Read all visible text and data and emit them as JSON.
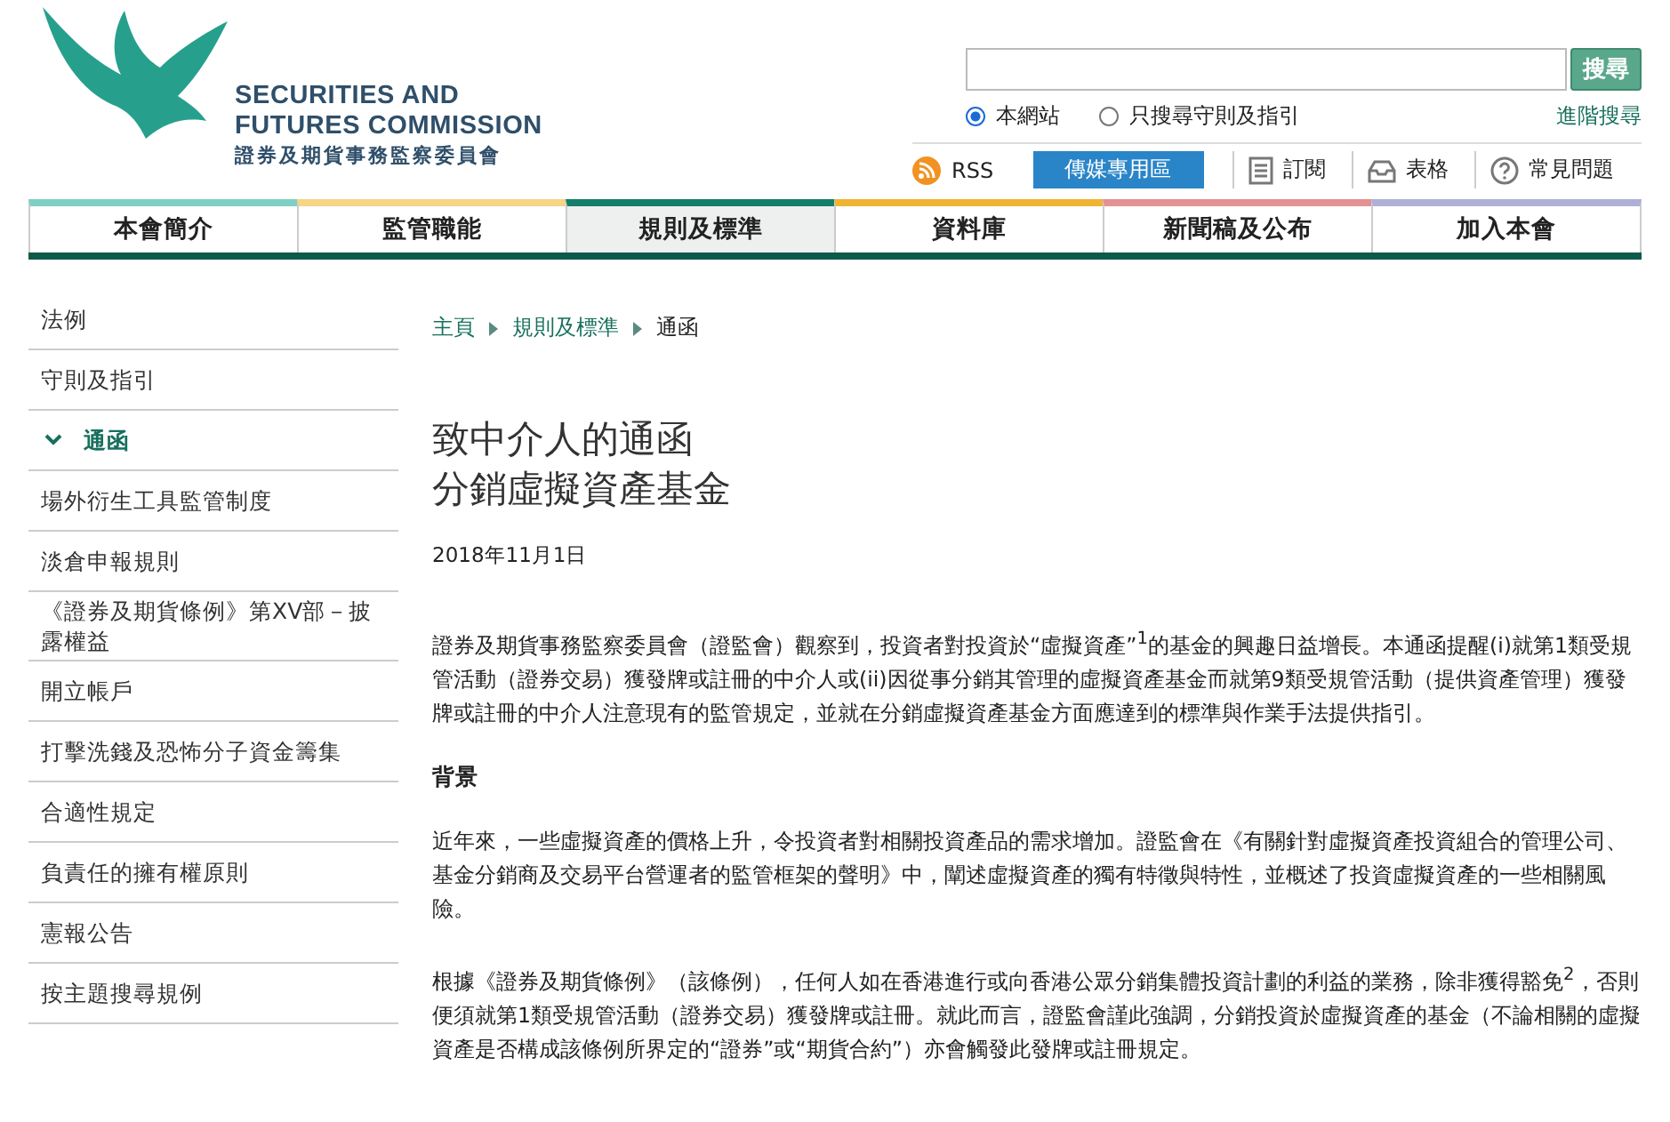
{
  "logo": {
    "name_lines": [
      "SECURITIES AND",
      "FUTURES COMMISSION"
    ],
    "chinese_name": "證券及期貨事務監察委員會"
  },
  "search": {
    "button": "搜尋",
    "scopes": [
      {
        "label": "本網站",
        "selected": true
      },
      {
        "label": "只搜尋守則及指引",
        "selected": false
      }
    ],
    "advanced": "進階搜尋"
  },
  "utility": {
    "rss": "RSS",
    "media": "傳媒專用區",
    "links": [
      {
        "kind": "subscribe",
        "label": "訂閱"
      },
      {
        "kind": "forms",
        "label": "表格"
      },
      {
        "kind": "faq",
        "label": "常見問題"
      }
    ]
  },
  "nav": [
    {
      "label": "本會簡介",
      "color": "#7fd0c4",
      "selected": false
    },
    {
      "label": "監管職能",
      "color": "#f6d585",
      "selected": false
    },
    {
      "label": "規則及標準",
      "color": "#128068",
      "selected": true
    },
    {
      "label": "資料庫",
      "color": "#f0b432",
      "selected": false
    },
    {
      "label": "新聞稿及公布",
      "color": "#e39193",
      "selected": false
    },
    {
      "label": "加入本會",
      "color": "#aeb0d8",
      "selected": false
    }
  ],
  "sidebar": [
    {
      "label": "法例",
      "selected": false
    },
    {
      "label": "守則及指引",
      "selected": false
    },
    {
      "label": "通函",
      "selected": true
    },
    {
      "label": "場外衍生工具監管制度",
      "selected": false
    },
    {
      "label": "淡倉申報規則",
      "selected": false
    },
    {
      "label": "《證券及期貨條例》第XV部－披露權益",
      "selected": false
    },
    {
      "label": "開立帳戶",
      "selected": false
    },
    {
      "label": "打擊洗錢及恐怖分子資金籌集",
      "selected": false
    },
    {
      "label": "合適性規定",
      "selected": false
    },
    {
      "label": "負責任的擁有權原則",
      "selected": false
    },
    {
      "label": "憲報公告",
      "selected": false
    },
    {
      "label": "按主題搜尋規例",
      "selected": false
    }
  ],
  "breadcrumb": [
    "主頁",
    "規則及標準",
    "通函"
  ],
  "title_lines": [
    "致中介人的通函",
    "分銷虛擬資產基金"
  ],
  "date": "2018年11月1日",
  "body": [
    {
      "kind": "paragraph",
      "text": "證券及期貨事務監察委員會（證監會）觀察到，投資者對投資於“虛擬資產”$^{1}$的基金的興趣日益增長。本通函提醒(i)就第1類受規管活動（證券交易）獲發牌或註冊的中介人或(ii)因從事分銷其管理的虛擬資產基金而就第9類受規管活動（提供資產管理）獲發牌或註冊的中介人注意現有的監管規定，並就在分銷虛擬資產基金方面應達到的標準與作業手法提供指引。"
    },
    {
      "kind": "heading",
      "text": "背景"
    },
    {
      "kind": "paragraph",
      "text": "近年來，一些虛擬資產的價格上升，令投資者對相關投資產品的需求增加。證監會在《有關針對虛擬資產投資組合的管理公司、基金分銷商及交易平台營運者的監管框架的聲明》中，闡述虛擬資產的獨有特徵與特性，並概述了投資虛擬資產的一些相關風險。"
    },
    {
      "kind": "paragraph",
      "text": "根據《證券及期貨條例》（該條例），任何人如在香港進行或向香港公眾分銷集體投資計劃的利益的業務，除非獲得豁免$^{2}$，否則便須就第1類受規管活動（證券交易）獲發牌或註冊。就此而言，證監會謹此強調，分銷投資於虛擬資產的基金（不論相關的虛擬資產是否構成該條例所界定的“證券”或“期貨合約”）亦會觸發此發牌或註冊規定。"
    }
  ]
}
